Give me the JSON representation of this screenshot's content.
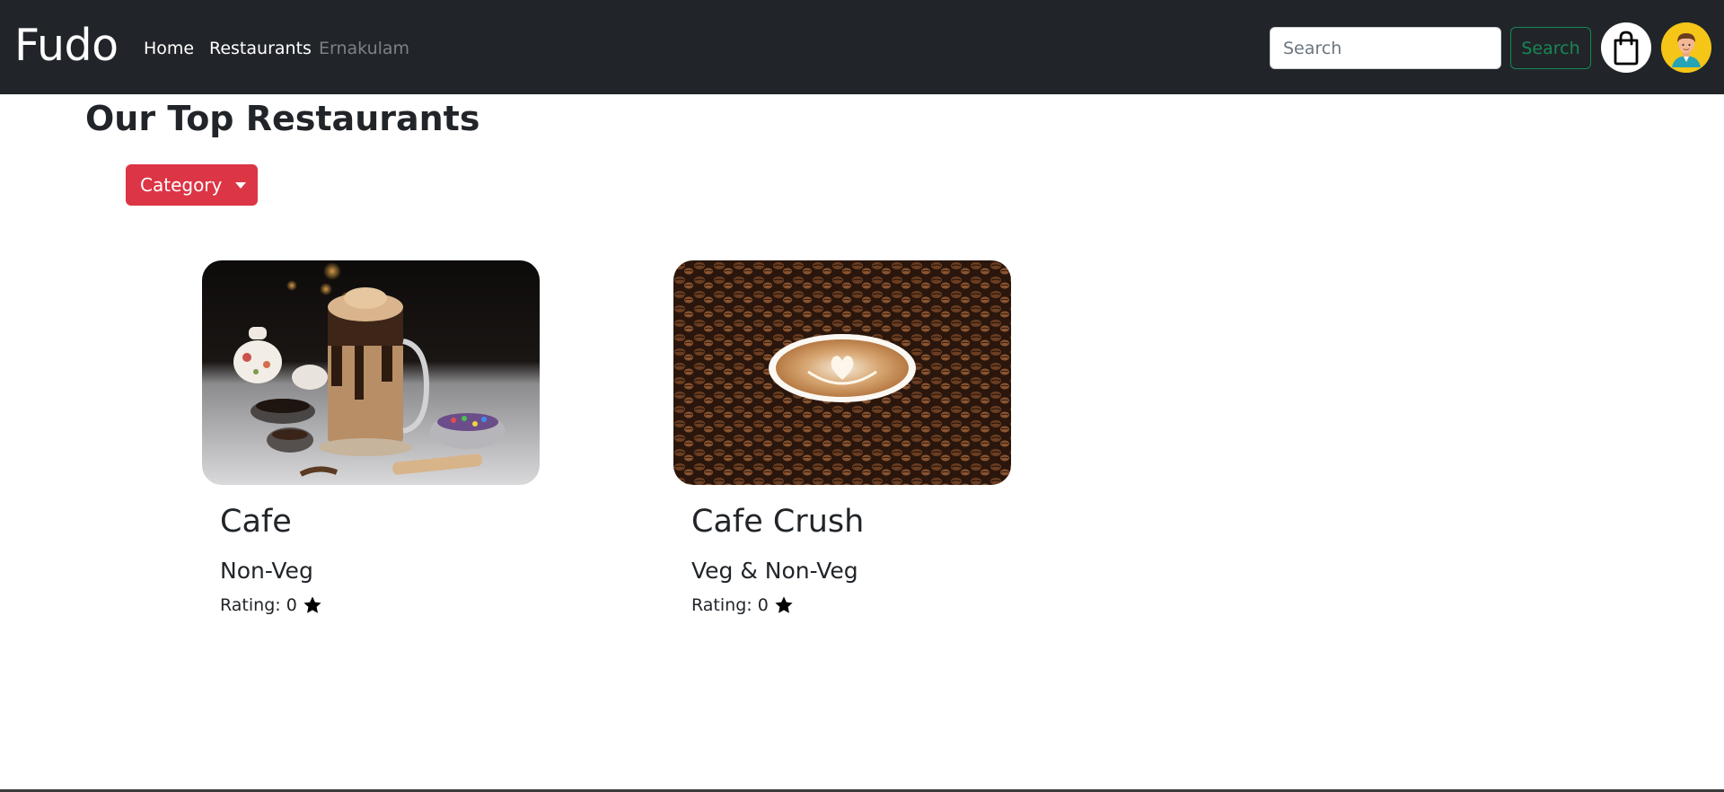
{
  "brand": "Fudo",
  "nav": {
    "home": "Home",
    "restaurants": "Restaurants",
    "location": "Ernakulam"
  },
  "search": {
    "placeholder": "Search",
    "button_label": "Search"
  },
  "icons": {
    "cart": "shopping-bag-icon",
    "avatar": "user-avatar-icon",
    "star": "star-icon"
  },
  "page_title": "Our Top Restaurants",
  "category_button": "Category",
  "restaurants": [
    {
      "name": "Cafe",
      "type": "Non-Veg",
      "rating_label": "Rating: 0",
      "image": "milkshake-dessert-photo"
    },
    {
      "name": "Cafe Crush",
      "type": "Veg & Non-Veg",
      "rating_label": "Rating: 0",
      "image": "latte-coffee-beans-photo"
    }
  ],
  "colors": {
    "navbar": "#212529",
    "search_button": "#198754",
    "category_button": "#dc3545",
    "avatar_bg": "#f5c518"
  }
}
